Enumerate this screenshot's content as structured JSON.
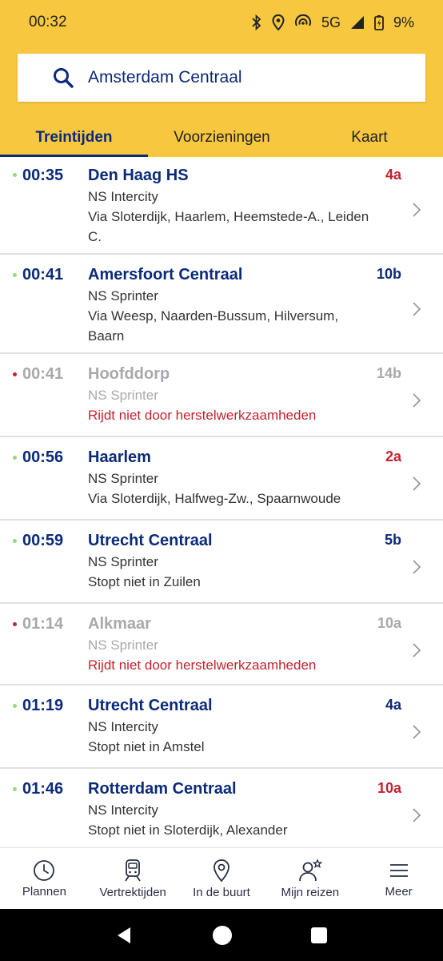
{
  "status_bar": {
    "time": "00:32",
    "network": "5G",
    "battery": "9%"
  },
  "search": {
    "value": "Amsterdam Centraal"
  },
  "tabs": [
    {
      "label": "Treintijden",
      "active": true
    },
    {
      "label": "Voorzieningen",
      "active": false
    },
    {
      "label": "Kaart",
      "active": false
    }
  ],
  "departures": [
    {
      "time": "00:35",
      "destination": "Den Haag HS",
      "type": "NS Intercity",
      "info": "Via Sloterdijk, Haarlem, Heemstede-A., Leiden C.",
      "track": "4a",
      "track_changed": true,
      "cancelled": false
    },
    {
      "time": "00:41",
      "destination": "Amersfoort Centraal",
      "type": "NS Sprinter",
      "info": "Via Weesp, Naarden-Bussum, Hilversum, Baarn",
      "track": "10b",
      "track_changed": false,
      "cancelled": false
    },
    {
      "time": "00:41",
      "destination": "Hoofddorp",
      "type": "NS Sprinter",
      "info": "Rijdt niet door herstelwerkzaamheden",
      "track": "14b",
      "track_changed": false,
      "cancelled": true
    },
    {
      "time": "00:56",
      "destination": "Haarlem",
      "type": "NS Sprinter",
      "info": "Via Sloterdijk, Halfweg-Zw., Spaarnwoude",
      "track": "2a",
      "track_changed": true,
      "cancelled": false
    },
    {
      "time": "00:59",
      "destination": "Utrecht Centraal",
      "type": "NS Sprinter",
      "info": "Stopt niet in Zuilen",
      "track": "5b",
      "track_changed": false,
      "cancelled": false
    },
    {
      "time": "01:14",
      "destination": "Alkmaar",
      "type": "NS Sprinter",
      "info": "Rijdt niet door herstelwerkzaamheden",
      "track": "10a",
      "track_changed": false,
      "cancelled": true
    },
    {
      "time": "01:19",
      "destination": "Utrecht Centraal",
      "type": "NS Intercity",
      "info": "Stopt niet in Amstel",
      "track": "4a",
      "track_changed": false,
      "cancelled": false
    },
    {
      "time": "01:46",
      "destination": "Rotterdam Centraal",
      "type": "NS Intercity",
      "info": "Stopt niet in Sloterdijk, Alexander",
      "track": "10a",
      "track_changed": true,
      "cancelled": false
    }
  ],
  "bottom_nav": [
    {
      "label": "Plannen",
      "icon": "clock-icon"
    },
    {
      "label": "Vertrektijden",
      "icon": "train-icon"
    },
    {
      "label": "In de buurt",
      "icon": "location-pin-icon"
    },
    {
      "label": "Mijn reizen",
      "icon": "user-star-icon"
    },
    {
      "label": "Meer",
      "icon": "menu-icon"
    }
  ],
  "colors": {
    "header": "#f7c740",
    "primary": "#0b2a7a",
    "delay_red": "#c4232f",
    "muted": "#a9a9ad",
    "dot_ok": "#9bd67a",
    "dot_cancelled": "#c4232f"
  }
}
